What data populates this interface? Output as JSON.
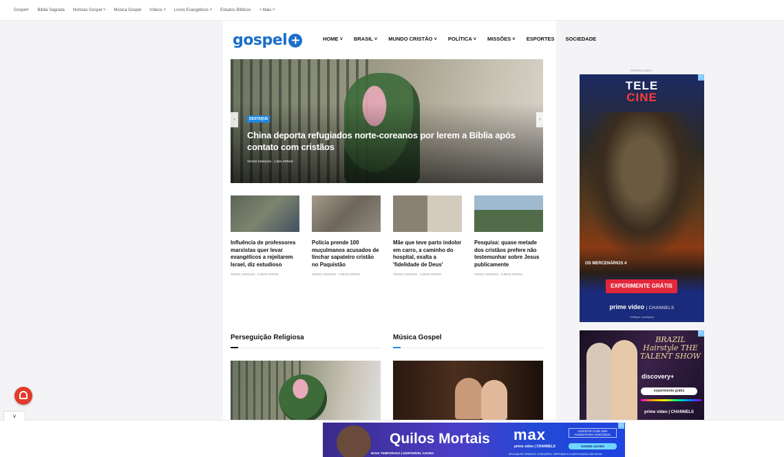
{
  "topbar": {
    "items": [
      "Gospel+",
      "Bíblia Sagrada",
      "Notícias Gospel ˅",
      "Música Gospel",
      "Vídeos ˅",
      "Livros Evangélicos ˅",
      "Estudos Bíblicos",
      "+ Mais ˅"
    ]
  },
  "header": {
    "logo_text": "gospel",
    "logo_symbol": "+",
    "nav": [
      "HOME ˅",
      "BRASIL ˅",
      "MUNDO CRISTÃO ˅",
      "POLÍTICA ˅",
      "MISSÕES ˅",
      "ESPORTES",
      "SOCIEDADE"
    ]
  },
  "hero": {
    "badge": "DESTAQUE",
    "title": "China deporta refugiados norte-coreanos por lerem a Bíblia após contato com cristãos",
    "meta": "TIAGO CHAGAS · 1 DIA ATRÁS",
    "prev": "‹",
    "next": "›"
  },
  "cards": [
    {
      "title": "Influência de professores marxistas quer levar evangélicos a rejeitarem Israel, diz estudioso",
      "meta": "TIAGO CHAGAS · 2 DIAS ATRÁS",
      "color": "#6d7463"
    },
    {
      "title": "Polícia prende 100 muçulmanos acusados de linchar sapateiro cristão no Paquistão",
      "meta": "TIAGO CHAGAS · 3 DIAS ATRÁS",
      "color": "#8a8477"
    },
    {
      "title": "Mãe que teve parto indolor em carro, a caminho do hospital, exalta a 'fidelidade de Deus'",
      "meta": "TIAGO CHAGAS · 3 DIAS ATRÁS",
      "color": "#b3aa9a"
    },
    {
      "title": "Pesquisa: quase metade dos cristãos prefere não testemunhar sobre Jesus publicamente",
      "meta": "TIAGO CHAGAS · 3 DIAS ATRÁS",
      "color": "#6d8aa6"
    }
  ],
  "sections": [
    {
      "title": "Perseguição Religiosa",
      "accent": "#111111"
    },
    {
      "title": "Música Gospel",
      "accent": "#1e88e5"
    }
  ],
  "ads": {
    "label": "PROPAGANDA",
    "telecine_1": "TELE",
    "telecine_2": "CINE",
    "movie": "OS MERCENÁRIOS 4",
    "cta": "EXPERIMENTE GRÁTIS",
    "prime": "prime video",
    "channels": "| CHANNELS",
    "fine": "Verifique condições",
    "brazil": "BRAZIL Hairstyle THE TALENT SHOW",
    "discovery": "discovery+",
    "cta2": "experimente grátis",
    "prime2": "prime video | CHANNELS",
    "bottom_title": "Quilos Mortais",
    "bottom_sub": "NOVA TEMPORADA | DISPONÍVEL AGORA",
    "max": "max",
    "max_pv": "prime video | CHANNELS",
    "assist": "ASSISTIR COM UMA ASSINATURA ADICIONAL",
    "assine": "ASSINE AGORA",
    "bottom_fine": "APLICAM-SE TERMOS E CONDIÇÕES. VERIFIQUE A CLASSIFICAÇÃO INDICATIVA."
  },
  "chevron": "˅"
}
